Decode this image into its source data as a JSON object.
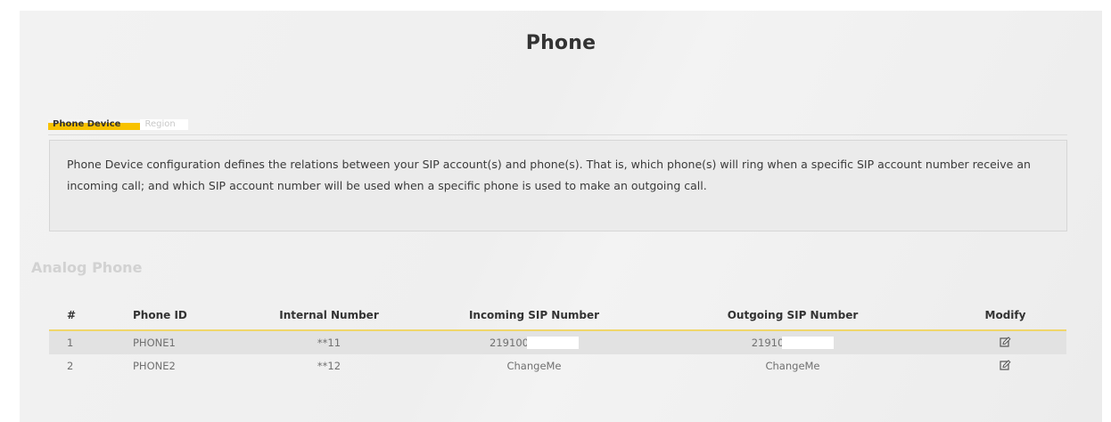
{
  "page": {
    "title": "Phone"
  },
  "tabs": [
    {
      "label": "Phone Device",
      "active": true
    },
    {
      "label": "Region",
      "active": false
    }
  ],
  "description": "Phone Device configuration defines the relations between your SIP account(s) and phone(s). That is, which phone(s) will ring when a specific SIP account number receive an incoming call; and which SIP account number will be used when a specific phone is used to make an outgoing call.",
  "section": {
    "title": "Analog Phone"
  },
  "table": {
    "headers": [
      "#",
      "Phone ID",
      "Internal Number",
      "Incoming SIP Number",
      "Outgoing SIP Number",
      "Modify"
    ],
    "rows": [
      {
        "num": "1",
        "phone_id": "PHONE1",
        "internal": "**11",
        "incoming": "219100",
        "outgoing": "21910",
        "modify_icon": "edit-icon"
      },
      {
        "num": "2",
        "phone_id": "PHONE2",
        "internal": "**12",
        "incoming": "ChangeMe",
        "outgoing": "ChangeMe",
        "modify_icon": "edit-icon"
      }
    ]
  },
  "colors": {
    "accent": "#f8c200",
    "header_rule": "#f0d66a",
    "row_alt": "#e2e2e2"
  }
}
